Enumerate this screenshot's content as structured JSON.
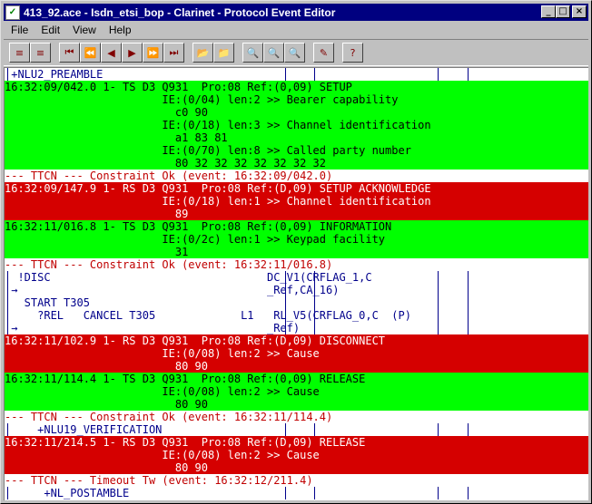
{
  "window": {
    "title": "413_92.ace - Isdn_etsi_bop - Clarinet - Protocol Event Editor",
    "minimize_glyph": "_",
    "maximize_glyph": "□",
    "close_glyph": "×"
  },
  "menu": [
    "File",
    "Edit",
    "View",
    "Help"
  ],
  "toolbar": {
    "tools": [
      {
        "name": "expand-icon",
        "glyph": "≡"
      },
      {
        "name": "collapse-icon",
        "glyph": "≡"
      },
      {
        "name": "first-icon",
        "glyph": "⏮"
      },
      {
        "name": "fast-back-icon",
        "glyph": "⏪"
      },
      {
        "name": "back-icon",
        "glyph": "◀"
      },
      {
        "name": "forward-icon",
        "glyph": "▶"
      },
      {
        "name": "fast-forward-icon",
        "glyph": "⏩"
      },
      {
        "name": "last-icon",
        "glyph": "⏭"
      },
      {
        "name": "open-folder-icon",
        "glyph": "📂"
      },
      {
        "name": "save-folder-icon",
        "glyph": "📁"
      },
      {
        "name": "find-icon",
        "glyph": "🔍"
      },
      {
        "name": "find-next-icon",
        "glyph": "🔍"
      },
      {
        "name": "find-prev-icon",
        "glyph": "🔍"
      },
      {
        "name": "edit-icon",
        "glyph": "✎"
      },
      {
        "name": "help-icon",
        "glyph": "?"
      }
    ]
  },
  "events": [
    {
      "type": "header",
      "lines": [
        " +NLU2_PREAMBLE"
      ]
    },
    {
      "type": "green",
      "lines": [
        "16:32:09/042.0 1- TS D3 Q931  Pro:08 Ref:(0,09) SETUP",
        "                        IE:(0/04) len:2 >> Bearer capability",
        "                          c0 90",
        "                        IE:(0/18) len:3 >> Channel identification",
        "                          a1 83 81",
        "                        IE:(0/70) len:8 >> Called party number",
        "                          80 32 32 32 32 32 32 32"
      ]
    },
    {
      "type": "ttcn",
      "lines": [
        "--- TTCN --- Constraint Ok (event: 16:32:09/042.0)"
      ]
    },
    {
      "type": "red",
      "lines": [
        "16:32:09/147.9 1- RS D3 Q931  Pro:08 Ref:(D,09) SETUP ACKNOWLEDGE",
        "                        IE:(0/18) len:1 >> Channel identification",
        "                          89"
      ]
    },
    {
      "type": "green",
      "lines": [
        "16:32:11/016.8 1- TS D3 Q931  Pro:08 Ref:(0,09) INFORMATION",
        "                        IE:(0/2c) len:1 >> Keypad facility",
        "                          31"
      ]
    },
    {
      "type": "ttcn",
      "lines": [
        "--- TTCN --- Constraint Ok (event: 16:32:11/016.8)"
      ]
    },
    {
      "type": "white",
      "lines": [
        "  !DISC                                 DC_V1(CRFLAG_1,C",
        " →                                      _Ref,CA_16)",
        "   START T305",
        "     ?REL   CANCEL T305             L1   RL_V5(CRFLAG_0,C  (P)",
        " →                                      _Ref)"
      ]
    },
    {
      "type": "red",
      "lines": [
        "16:32:11/102.9 1- RS D3 Q931  Pro:08 Ref:(D,09) DISCONNECT",
        "                        IE:(0/08) len:2 >> Cause",
        "                          80 90"
      ]
    },
    {
      "type": "green",
      "lines": [
        "16:32:11/114.4 1- TS D3 Q931  Pro:08 Ref:(0,09) RELEASE",
        "                        IE:(0/08) len:2 >> Cause",
        "                          80 90"
      ]
    },
    {
      "type": "ttcn",
      "lines": [
        "--- TTCN --- Constraint Ok (event: 16:32:11/114.4)"
      ]
    },
    {
      "type": "header",
      "lines": [
        "     +NLU19_VERIFICATION"
      ]
    },
    {
      "type": "red",
      "lines": [
        "16:32:11/214.5 1- RS D3 Q931  Pro:08 Ref:(D,09) RELEASE",
        "                        IE:(0/08) len:2 >> Cause",
        "                          80 90"
      ]
    },
    {
      "type": "ttcn",
      "lines": [
        "--- TTCN --- Timeout Tw (event: 16:32:12/211.4)"
      ]
    },
    {
      "type": "header",
      "lines": [
        "      +NL_POSTAMBLE"
      ]
    }
  ]
}
